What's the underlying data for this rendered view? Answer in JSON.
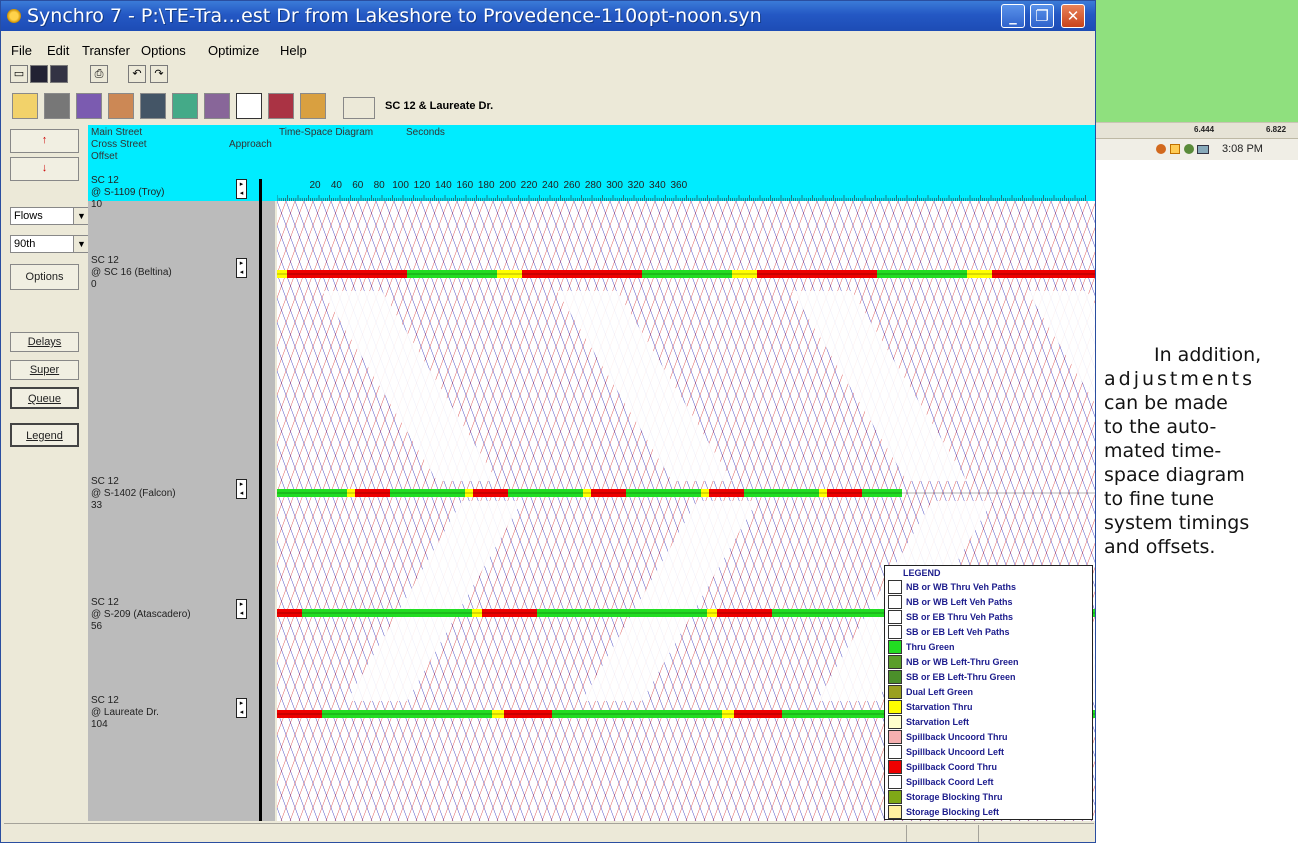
{
  "window": {
    "title": "Synchro 7 - P:\\TE-Tra…est Dr from Lakeshore to Provedence-110opt-noon.syn",
    "controls": {
      "minimize": "_",
      "restore": "❐",
      "close": "✕"
    }
  },
  "menu": [
    "File",
    "Edit",
    "Transfer",
    "Options",
    "Optimize",
    "Help"
  ],
  "toolbar_small": [
    "open-icon",
    "save-icon",
    "save-as-icon",
    "print-icon",
    "undo-icon",
    "redo-icon"
  ],
  "toolbar_big": [
    "map-view-icon",
    "lanes-icon",
    "volumes-icon",
    "timing-icon",
    "phasing-icon",
    "simulation-icon",
    "detectors-icon",
    "time-space-icon",
    "sim-traffic-icon",
    "reports-icon"
  ],
  "location": "SC 12 & Laureate Dr.",
  "left_panel": {
    "flows_select": "Flows",
    "percentile_select": "90th",
    "options_button": "Options",
    "delays_button": "Delays",
    "super_button": "Super",
    "queue_button": "Queue",
    "legend_button": "Legend"
  },
  "header": {
    "col1": [
      "Main Street",
      "Cross Street",
      "Offset"
    ],
    "approach": "Approach",
    "diagram_title": "Time-Space Diagram",
    "units": "Seconds",
    "ticks": [
      20,
      40,
      60,
      80,
      100,
      120,
      140,
      160,
      180,
      200,
      220,
      240,
      260,
      280,
      300,
      320,
      340,
      360
    ]
  },
  "intersections": [
    {
      "main": "SC 12",
      "cross": "@ S-1109 (Troy)",
      "offset": "10"
    },
    {
      "main": "SC 12",
      "cross": "@ SC 16 (Beltina)",
      "offset": "0"
    },
    {
      "main": "SC 12",
      "cross": "@ S-1402 (Falcon)",
      "offset": "33"
    },
    {
      "main": "SC 12",
      "cross": "@ S-209 (Atascadero)",
      "offset": "56"
    },
    {
      "main": "SC 12",
      "cross": "@ Laureate Dr.",
      "offset": "104"
    }
  ],
  "legend": {
    "title": "LEGEND",
    "items": [
      {
        "label": "NB or WB Thru Veh Paths",
        "color": "#ffffff"
      },
      {
        "label": "NB or WB Left Veh Paths",
        "color": "#ffffff"
      },
      {
        "label": "SB or EB Thru Veh Paths",
        "color": "#ffffff"
      },
      {
        "label": "SB or EB Left Veh Paths",
        "color": "#ffffff"
      },
      {
        "label": "Thru Green",
        "color": "#22dd22"
      },
      {
        "label": "NB or WB Left-Thru Green",
        "color": "#5a9e2a"
      },
      {
        "label": "SB or EB Left-Thru Green",
        "color": "#4b8f2a"
      },
      {
        "label": "Dual Left Green",
        "color": "#9aa020"
      },
      {
        "label": "Starvation Thru",
        "color": "#ffff00"
      },
      {
        "label": "Starvation Left",
        "color": "#ffffcc"
      },
      {
        "label": "Spillback Uncoord Thru",
        "color": "#f6b0b0"
      },
      {
        "label": "Spillback Uncoord Left",
        "color": "#ffffff"
      },
      {
        "label": "Spillback Coord Thru",
        "color": "#ee0000"
      },
      {
        "label": "Spillback Coord Left",
        "color": "#ffffff"
      },
      {
        "label": "Storage Blocking Thru",
        "color": "#7fa817"
      },
      {
        "label": "Storage Blocking Left",
        "color": "#fff0a0"
      }
    ]
  },
  "taskbar": {
    "values": [
      "6.444",
      "6.822"
    ],
    "time": "3:08 PM"
  },
  "side_text": [
    "In addition,",
    "adjustments",
    "can be made",
    "to the auto-",
    "mated time-",
    "space diagram",
    "to fine tune",
    "system timings",
    "and offsets."
  ],
  "colors": {
    "header": "#00ecff",
    "green_bg": "#8fe07e",
    "thru_green": "#22dd22",
    "coord_red": "#ee0000",
    "starvation_yellow": "#ffff00",
    "path_red": "#d01010",
    "path_blue": "#1010b0"
  }
}
